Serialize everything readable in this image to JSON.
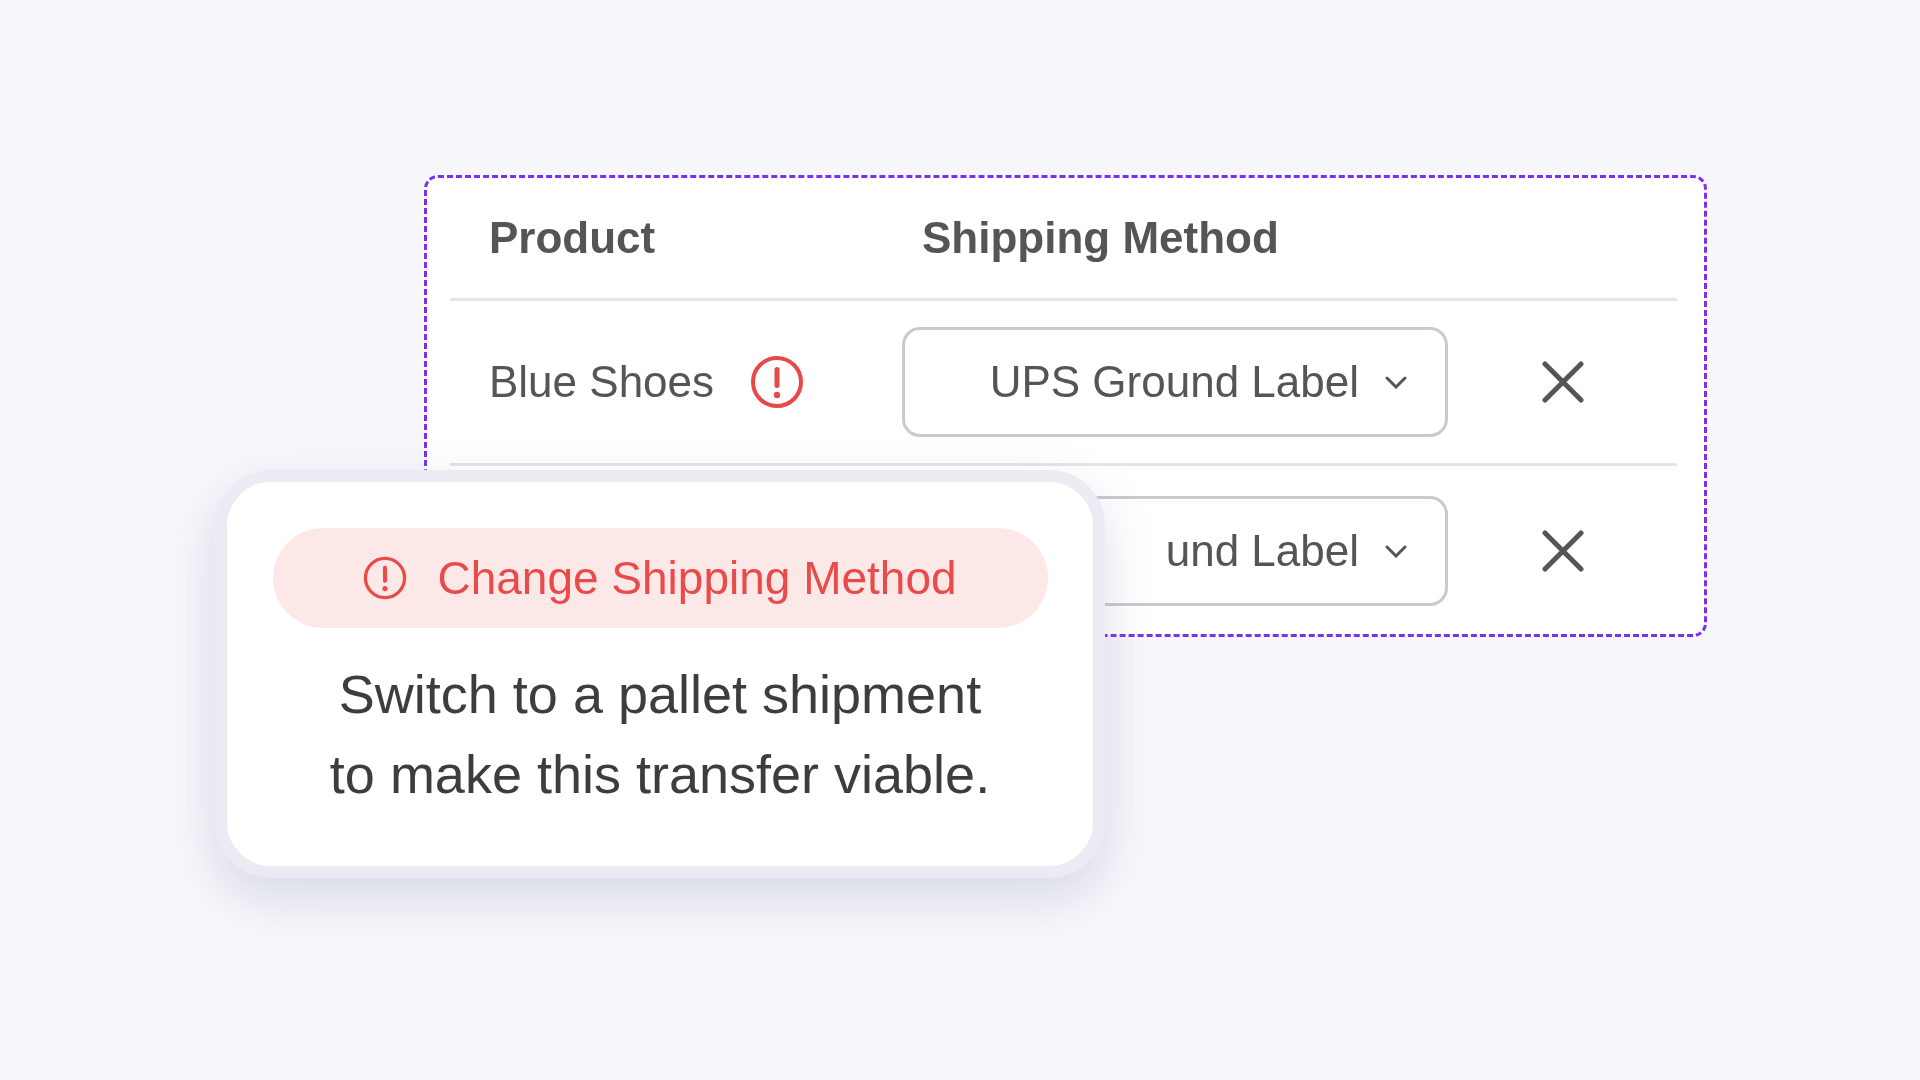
{
  "table": {
    "columns": [
      "Product",
      "Shipping Method"
    ],
    "rows": [
      {
        "product": "Blue Shoes",
        "warning": true,
        "shipping_method": "UPS Ground Label"
      },
      {
        "shipping_method": "und Label"
      }
    ]
  },
  "tooltip": {
    "badge": "Change Shipping Method",
    "message_lines": [
      "Switch to a pallet shipment",
      "to make this transfer viable."
    ]
  }
}
